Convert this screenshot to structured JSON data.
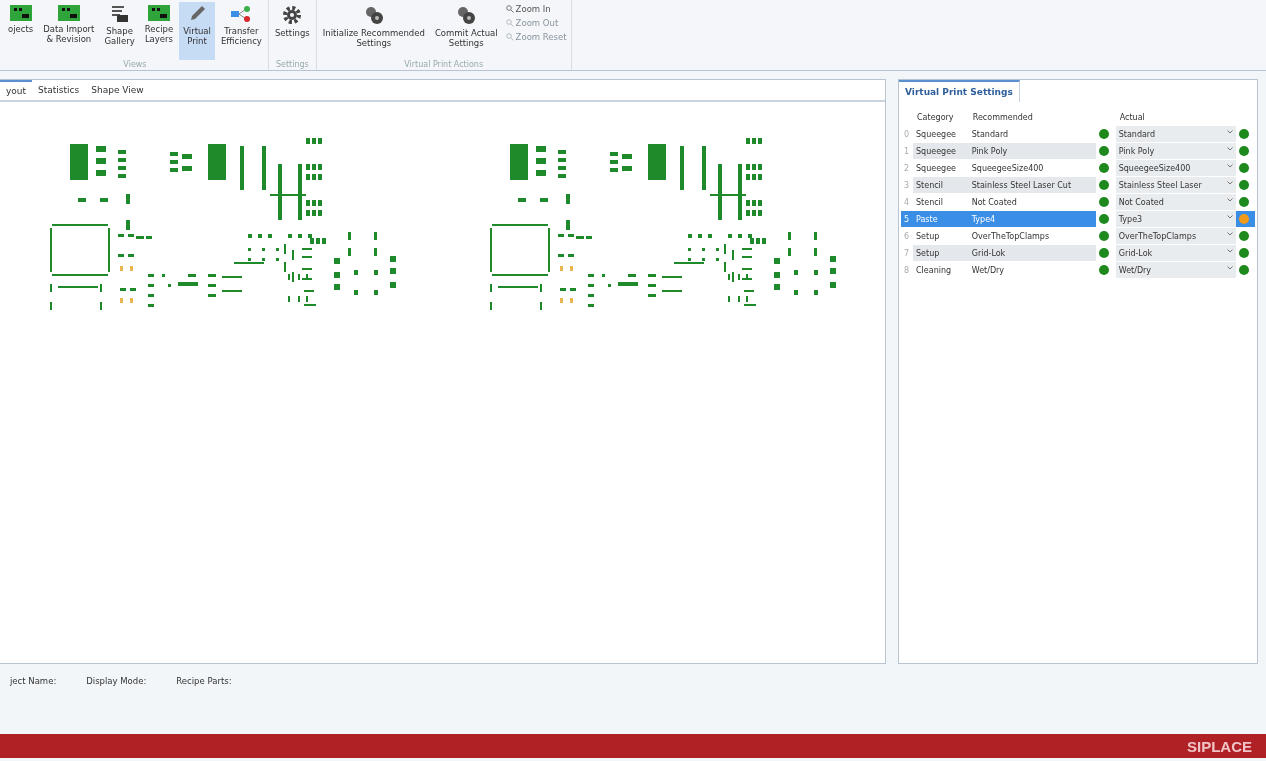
{
  "ribbon": {
    "groups": [
      {
        "label": "Views",
        "buttons": [
          {
            "label": "ojects",
            "kind": "board",
            "selected": false
          },
          {
            "label": "Data Import\n& Revision",
            "kind": "board",
            "selected": false
          },
          {
            "label": "Shape\nGallery",
            "kind": "shapes",
            "selected": false
          },
          {
            "label": "Recipe\nLayers",
            "kind": "board",
            "selected": false
          },
          {
            "label": "Virtual\nPrint",
            "kind": "pen",
            "selected": true
          },
          {
            "label": "Transfer\nEfficiency",
            "kind": "network",
            "selected": false
          }
        ]
      },
      {
        "label": "Settings",
        "buttons": [
          {
            "label": "Settings",
            "kind": "gear",
            "selected": false
          }
        ]
      },
      {
        "label": "Virtual Print Actions",
        "buttons": [
          {
            "label": "Initialize Recommended\nSettings",
            "kind": "gears",
            "selected": false
          },
          {
            "label": "Commit Actual\nSettings",
            "kind": "gears",
            "selected": false
          }
        ],
        "small_buttons": [
          {
            "label": "Zoom In",
            "disabled": false
          },
          {
            "label": "Zoom Out",
            "disabled": true
          },
          {
            "label": "Zoom Reset",
            "disabled": true
          }
        ]
      }
    ]
  },
  "layout_tabs": [
    {
      "label": "yout",
      "selected": true
    },
    {
      "label": "Statistics",
      "selected": false
    },
    {
      "label": "Shape View",
      "selected": false
    }
  ],
  "settings_panel": {
    "tab": "Virtual Print Settings",
    "columns": [
      "Category",
      "Recommended",
      "Actual"
    ],
    "rows": [
      {
        "index": "0",
        "category": "Squeegee",
        "recommended": "Standard",
        "recommended_warning": false,
        "actual": "Standard",
        "actual_warning": false,
        "selected": false
      },
      {
        "index": "1",
        "category": "Squeegee",
        "recommended": "Pink Poly",
        "recommended_warning": false,
        "actual": "Pink Poly",
        "actual_warning": false,
        "selected": false
      },
      {
        "index": "2",
        "category": "Squeegee",
        "recommended": "SqueegeeSize400",
        "recommended_warning": false,
        "actual": "SqueegeeSize400",
        "actual_warning": false,
        "selected": false
      },
      {
        "index": "3",
        "category": "Stencil",
        "recommended": "Stainless Steel Laser Cut",
        "recommended_warning": false,
        "actual": "Stainless Steel Laser",
        "actual_warning": false,
        "selected": false
      },
      {
        "index": "4",
        "category": "Stencil",
        "recommended": "Not Coated",
        "recommended_warning": false,
        "actual": "Not Coated",
        "actual_warning": false,
        "selected": false
      },
      {
        "index": "5",
        "category": "Paste",
        "recommended": "Type4",
        "recommended_warning": false,
        "actual": "Type3",
        "actual_warning": true,
        "selected": true
      },
      {
        "index": "6",
        "category": "Setup",
        "recommended": "OverTheTopClamps",
        "recommended_warning": false,
        "actual": "OverTheTopClamps",
        "actual_warning": false,
        "selected": false
      },
      {
        "index": "7",
        "category": "Setup",
        "recommended": "Grid-Lok",
        "recommended_warning": false,
        "actual": "Grid-Lok",
        "actual_warning": false,
        "selected": false
      },
      {
        "index": "8",
        "category": "Cleaning",
        "recommended": "Wet/Dry",
        "recommended_warning": false,
        "actual": "Wet/Dry",
        "actual_warning": false,
        "selected": false
      }
    ]
  },
  "status_fields": [
    "ject Name:",
    "Display Mode:",
    "Recipe Parts:"
  ],
  "footer": {
    "brand": "SIPLACE"
  }
}
